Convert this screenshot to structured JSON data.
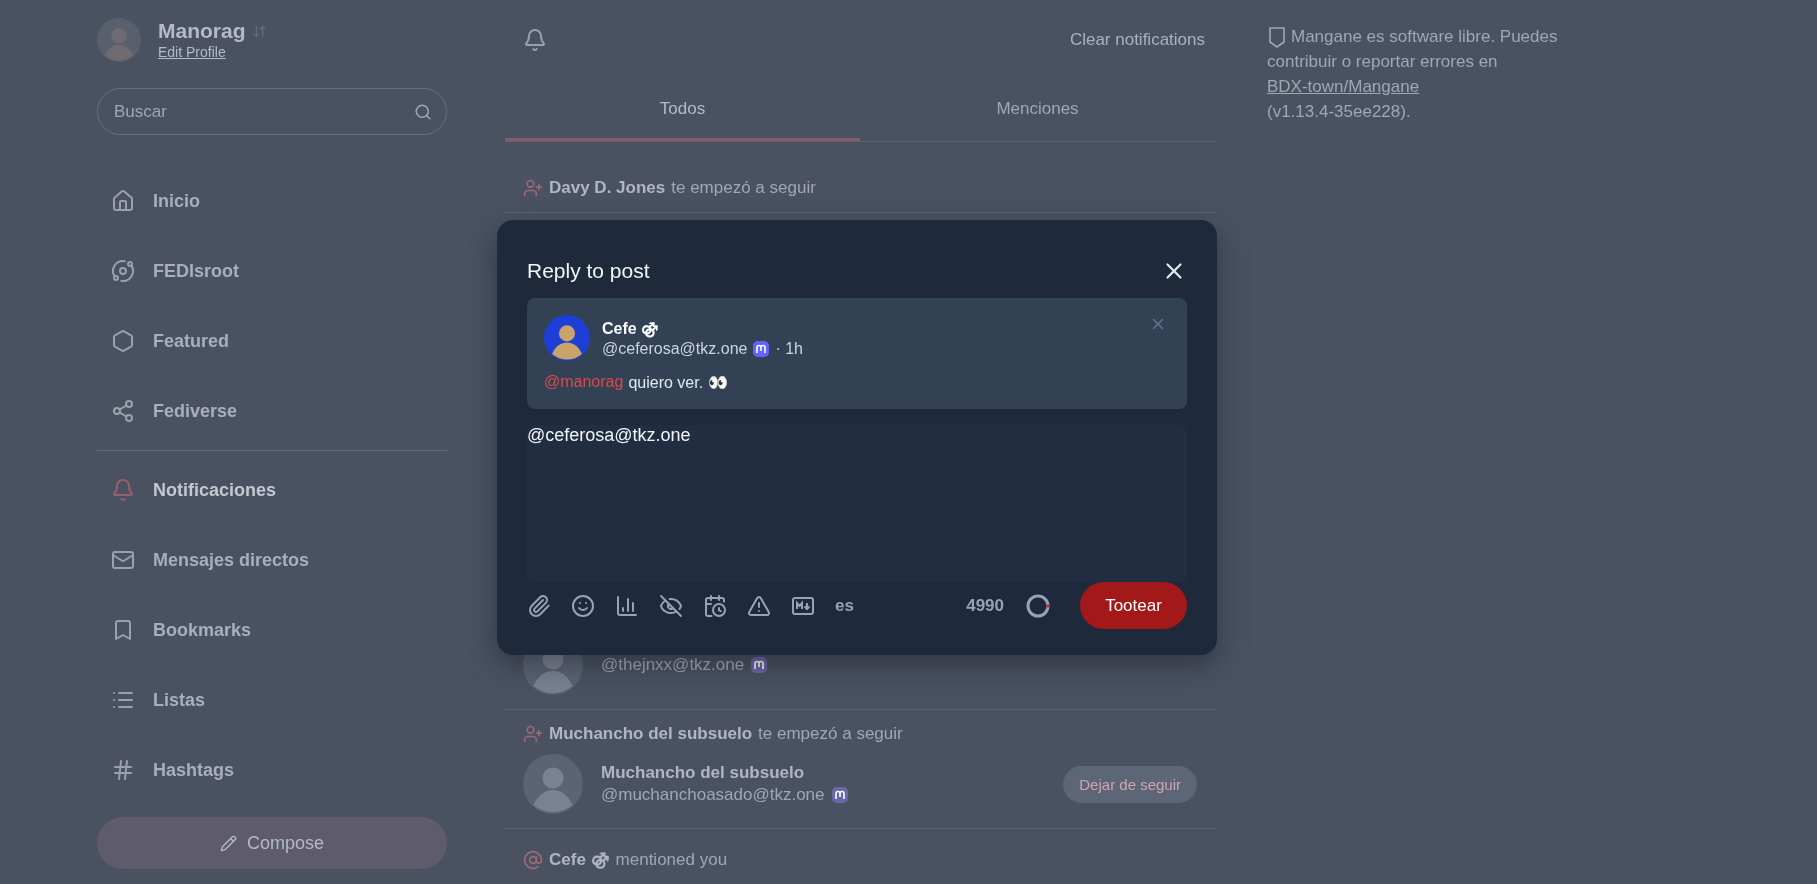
{
  "sidebar": {
    "profile": {
      "name": "Manorag",
      "link": "Edit Profile"
    },
    "search": {
      "placeholder": "Buscar"
    },
    "nav": [
      {
        "label": "Inicio",
        "selected": false
      },
      {
        "label": "FEDIsroot",
        "selected": false
      },
      {
        "label": "Featured",
        "selected": false
      },
      {
        "label": "Fediverse",
        "selected": false
      },
      {
        "label": "Notificaciones",
        "selected": true
      },
      {
        "label": "Mensajes directos",
        "selected": false
      },
      {
        "label": "Bookmarks",
        "selected": false
      },
      {
        "label": "Listas",
        "selected": false
      },
      {
        "label": "Hashtags",
        "selected": false
      }
    ],
    "compose": "Compose"
  },
  "feed": {
    "clear_button": "Clear notifications",
    "tabs": [
      {
        "label": "Todos",
        "selected": true
      },
      {
        "label": "Menciones",
        "selected": false
      }
    ],
    "notifications": [
      {
        "kind": "follow",
        "actor": "Davy D. Jones",
        "action": "te empezó a seguir"
      },
      {
        "kind": "account",
        "account": {
          "handle": "@thejnxx@tkz.one"
        }
      },
      {
        "kind": "follow",
        "actor": "Muchancho del subsuelo",
        "action": "te empezó a seguir",
        "account": {
          "name": "Muchancho del subsuelo",
          "handle": "@muchanchoasado@tkz.one",
          "button": "Dejar de seguir"
        }
      },
      {
        "kind": "mention",
        "actor": "Cefe ⚣",
        "action": "mentioned you"
      }
    ]
  },
  "about": {
    "text_1": "Mangane es software libre. Puedes",
    "text_2": "contribuir o reportar errores en",
    "link": "BDX-town/Mangane",
    "version": "(v1.13.4-35ee228)."
  },
  "modal": {
    "title": "Reply to post",
    "quote": {
      "name": "Cefe ⚣",
      "handle": "@ceferosa@tkz.one",
      "time": "· 1h",
      "mention": "@manorag",
      "text": "quiero ver. 👀"
    },
    "value": "@ceferosa@tkz.one",
    "language": "es",
    "counter": "4990",
    "submit": "Tootear"
  }
}
